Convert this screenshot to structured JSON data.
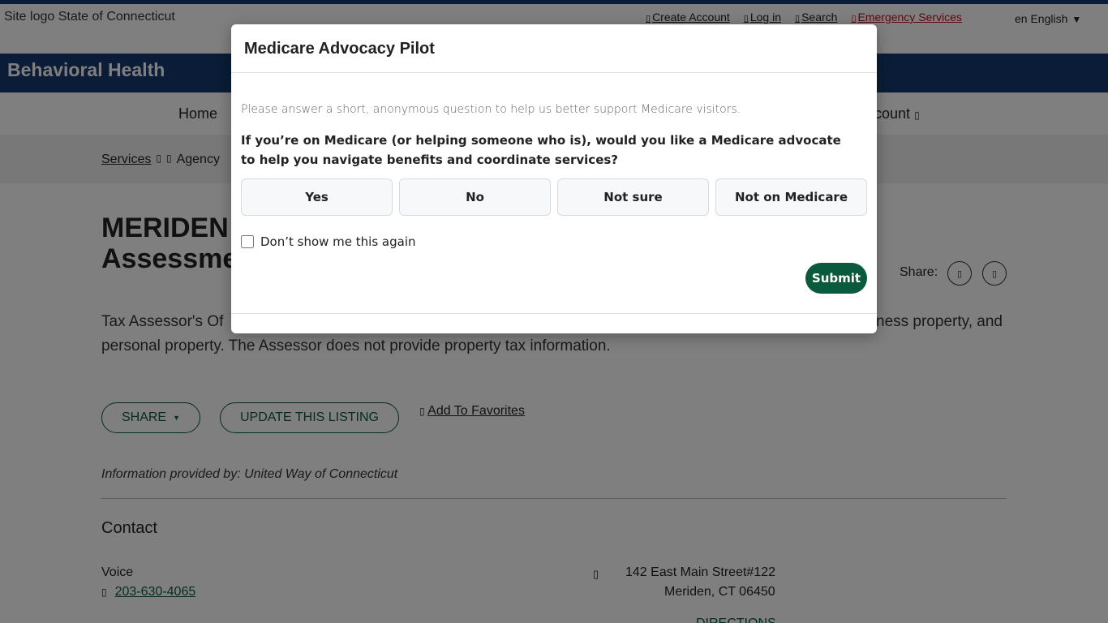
{
  "header": {
    "logo_alt": "Site logo",
    "site_name": "State of Connecticut",
    "create_account": "Create Account",
    "log_in": "Log in",
    "search": "Search",
    "emergency": "Emergency Services",
    "lang_code": "en",
    "language": "English"
  },
  "banner": {
    "title": "Behavioral Health"
  },
  "nav": {
    "home": "Home",
    "account": "count"
  },
  "breadcrumb": {
    "services": "Services",
    "agency": "Agency"
  },
  "listing": {
    "title_line1": "MERIDEN",
    "title_line2": "Assessme",
    "share_label": "Share:",
    "desc_start": "Tax Assessor's Of",
    "desc_end": "ness property, and",
    "desc_line2": "personal property. The Assessor does not provide property tax information.",
    "share_button": "SHARE",
    "update_button": "UPDATE THIS LISTING",
    "favorites": "Add To Favorites",
    "info_provided": "Information provided by: United Way of Connecticut"
  },
  "contact": {
    "heading": "Contact",
    "voice_label": "Voice",
    "phone": "203-630-4065",
    "address_line1": "142 East Main Street#122",
    "address_line2": "Meriden, CT 06450",
    "directions": "DIRECTIONS"
  },
  "modal": {
    "title": "Medicare Advocacy Pilot",
    "intro": "Please answer a short, anonymous question to help us better support Medicare visitors.",
    "question": "If you’re on Medicare (or helping someone who is), would you like a Medicare advocate to help you navigate benefits and coordinate services?",
    "options": [
      "Yes",
      "No",
      "Not sure",
      "Not on Medicare"
    ],
    "dont_show": "Don’t show me this again",
    "submit": "Submit"
  },
  "colors": {
    "brand_blue": "#14386f",
    "green": "#0a5b3e",
    "emergency_red": "#b5121b"
  }
}
